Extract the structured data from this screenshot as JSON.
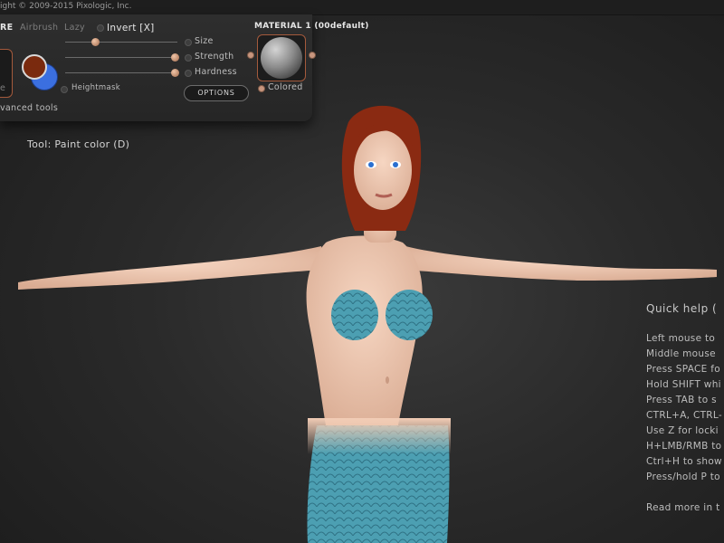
{
  "topbar": {
    "copyright": "ight © 2009-2015 Pixologic, Inc."
  },
  "brush_panel": {
    "section_label": "RE",
    "airbrush": "Airbrush",
    "lazy": "Lazy",
    "invert": "Invert [X]",
    "size": "Size",
    "strength": "Strength",
    "hardness": "Hardness",
    "brush_label_fragment": "e",
    "heightmask": "Heightmask",
    "advanced": "vanced tools",
    "options_button": "OPTIONS",
    "primary_color": "#7a2a0e",
    "secondary_color": "#3b6fe0"
  },
  "sliders": {
    "size": 0.27,
    "strength": 0.98,
    "hardness": 0.98
  },
  "material": {
    "title": "MATERIAL 1 (00default)",
    "colored": "Colored"
  },
  "tool": {
    "label": "Tool: Paint color (D)"
  },
  "quick_help": {
    "title": "Quick help (",
    "lines": [
      "Left mouse to",
      "Middle mouse",
      "Press SPACE fo",
      "Hold SHIFT whi",
      "Press TAB to s",
      "CTRL+A, CTRL-",
      "Use Z for locki",
      "H+LMB/RMB to",
      "Ctrl+H to show",
      "Press/hold P to"
    ],
    "read_more": "Read more in t"
  },
  "colors": {
    "skin": "#f2cdb6",
    "hair": "#8a2a12",
    "tail": "#4c9fb2",
    "accent": "#a45a3c"
  }
}
